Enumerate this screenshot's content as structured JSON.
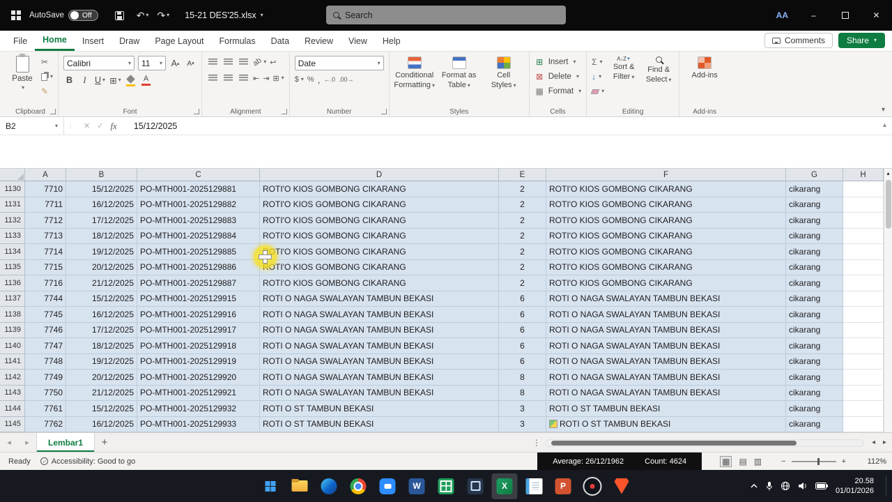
{
  "icons": {
    "caret": "▾",
    "chevron_up": "▴",
    "close": "✕",
    "minimize": "–",
    "check": "✓",
    "undo": "↶",
    "redo": "↷",
    "scissors": "✂",
    "brush": "✎",
    "sigma": "Σ",
    "down_arrow": "↓",
    "borders": "⊞",
    "merge": "⊞",
    "wrap": "↩",
    "indent_out": "⇤",
    "indent_in": "⇥",
    "orientation": "ab",
    "dollar": "$",
    "percent": "%",
    "comma": ",",
    "dec_inc": "←.0",
    "dec_dec": ".00→",
    "insert": "⊞",
    "delete": "⊠",
    "format": "▦",
    "view_normal": "▦",
    "view_layout": "▤",
    "view_break": "▥",
    "scroll_up": "▴",
    "prev": "◂",
    "next": "▸",
    "dots": "⋮",
    "plus": "+",
    "funnel": "▼",
    "grow_font": "A",
    "shrink_font": "A",
    "minus": "−",
    "plus_zoom": "+"
  },
  "titlebar": {
    "autosave_label": "AutoSave",
    "autosave_state": "Off",
    "file_name": "15-21 DES'25.xlsx",
    "search_placeholder": "Search",
    "avatar": "AA"
  },
  "ribbon": {
    "tabs": [
      {
        "label": "File"
      },
      {
        "label": "Home",
        "active": true
      },
      {
        "label": "Insert"
      },
      {
        "label": "Draw"
      },
      {
        "label": "Page Layout"
      },
      {
        "label": "Formulas"
      },
      {
        "label": "Data"
      },
      {
        "label": "Review"
      },
      {
        "label": "View"
      },
      {
        "label": "Help"
      }
    ],
    "comments_label": "Comments",
    "share_label": "Share",
    "clipboard": {
      "paste": "Paste",
      "label": "Clipboard"
    },
    "font": {
      "name": "Calibri",
      "size": "11",
      "bold": "B",
      "italic": "I",
      "underline": "U",
      "color_letter": "A",
      "label": "Font"
    },
    "alignment": {
      "label": "Alignment"
    },
    "number": {
      "format": "Date",
      "label": "Number"
    },
    "styles": {
      "cf": [
        "Conditional",
        "Formatting"
      ],
      "fat": [
        "Format as",
        "Table"
      ],
      "cs": [
        "Cell",
        "Styles"
      ],
      "label": "Styles"
    },
    "cells": {
      "insert": "Insert",
      "del": "Delete",
      "format": "Format",
      "label": "Cells"
    },
    "editing": {
      "sort": [
        "Sort &",
        "Filter"
      ],
      "find": [
        "Find &",
        "Select"
      ],
      "label": "Editing"
    },
    "addins": {
      "button": "Add-ins",
      "label": "Add-ins"
    }
  },
  "formula": {
    "name_box": "B2",
    "fx": "fx",
    "value": "15/12/2025"
  },
  "grid": {
    "columns": [
      "A",
      "B",
      "C",
      "D",
      "E",
      "F",
      "G",
      "H"
    ],
    "rows": [
      [
        1130,
        "7710",
        "15/12/2025",
        "PO-MTH001-2025129881",
        "ROTI'O KIOS GOMBONG CIKARANG",
        "2",
        "ROTI'O KIOS GOMBONG CIKARANG",
        "cikarang"
      ],
      [
        1131,
        "7711",
        "16/12/2025",
        "PO-MTH001-2025129882",
        "ROTI'O KIOS GOMBONG CIKARANG",
        "2",
        "ROTI'O KIOS GOMBONG CIKARANG",
        "cikarang"
      ],
      [
        1132,
        "7712",
        "17/12/2025",
        "PO-MTH001-2025129883",
        "ROTI'O KIOS GOMBONG CIKARANG",
        "2",
        "ROTI'O KIOS GOMBONG CIKARANG",
        "cikarang"
      ],
      [
        1133,
        "7713",
        "18/12/2025",
        "PO-MTH001-2025129884",
        "ROTI'O KIOS GOMBONG CIKARANG",
        "2",
        "ROTI'O KIOS GOMBONG CIKARANG",
        "cikarang"
      ],
      [
        1134,
        "7714",
        "19/12/2025",
        "PO-MTH001-2025129885",
        "ROTI'O KIOS GOMBONG CIKARANG",
        "2",
        "ROTI'O KIOS GOMBONG CIKARANG",
        "cikarang"
      ],
      [
        1135,
        "7715",
        "20/12/2025",
        "PO-MTH001-2025129886",
        "ROTI'O KIOS GOMBONG CIKARANG",
        "2",
        "ROTI'O KIOS GOMBONG CIKARANG",
        "cikarang"
      ],
      [
        1136,
        "7716",
        "21/12/2025",
        "PO-MTH001-2025129887",
        "ROTI'O KIOS GOMBONG CIKARANG",
        "2",
        "ROTI'O KIOS GOMBONG CIKARANG",
        "cikarang"
      ],
      [
        1137,
        "7744",
        "15/12/2025",
        "PO-MTH001-2025129915",
        "ROTI O NAGA SWALAYAN TAMBUN BEKASI",
        "6",
        "ROTI O NAGA SWALAYAN TAMBUN BEKASI",
        "cikarang"
      ],
      [
        1138,
        "7745",
        "16/12/2025",
        "PO-MTH001-2025129916",
        "ROTI O NAGA SWALAYAN TAMBUN BEKASI",
        "6",
        "ROTI O NAGA SWALAYAN TAMBUN BEKASI",
        "cikarang"
      ],
      [
        1139,
        "7746",
        "17/12/2025",
        "PO-MTH001-2025129917",
        "ROTI O NAGA SWALAYAN TAMBUN BEKASI",
        "6",
        "ROTI O NAGA SWALAYAN TAMBUN BEKASI",
        "cikarang"
      ],
      [
        1140,
        "7747",
        "18/12/2025",
        "PO-MTH001-2025129918",
        "ROTI O NAGA SWALAYAN TAMBUN BEKASI",
        "6",
        "ROTI O NAGA SWALAYAN TAMBUN BEKASI",
        "cikarang"
      ],
      [
        1141,
        "7748",
        "19/12/2025",
        "PO-MTH001-2025129919",
        "ROTI O NAGA SWALAYAN TAMBUN BEKASI",
        "6",
        "ROTI O NAGA SWALAYAN TAMBUN BEKASI",
        "cikarang"
      ],
      [
        1142,
        "7749",
        "20/12/2025",
        "PO-MTH001-2025129920",
        "ROTI O NAGA SWALAYAN TAMBUN BEKASI",
        "8",
        "ROTI O NAGA SWALAYAN TAMBUN BEKASI",
        "cikarang"
      ],
      [
        1143,
        "7750",
        "21/12/2025",
        "PO-MTH001-2025129921",
        "ROTI O NAGA SWALAYAN TAMBUN BEKASI",
        "8",
        "ROTI O NAGA SWALAYAN TAMBUN BEKASI",
        "cikarang"
      ],
      [
        1144,
        "7761",
        "15/12/2025",
        "PO-MTH001-2025129932",
        "ROTI O ST TAMBUN BEKASI",
        "3",
        "ROTI O ST TAMBUN BEKASI",
        "cikarang"
      ],
      [
        1145,
        "7762",
        "16/12/2025",
        "PO-MTH001-2025129933",
        "ROTI O ST TAMBUN BEKASI",
        "3",
        "ROTI O ST TAMBUN BEKASI",
        "cikarang"
      ]
    ]
  },
  "sheet": {
    "tab": "Lembar1"
  },
  "status": {
    "ready": "Ready",
    "accessibility": "Accessibility: Good to go",
    "average": "Average: 26/12/1962",
    "count": "Count: 4624",
    "zoom": "112%"
  },
  "taskbar": {
    "time": "20.58",
    "date": "01/01/2026",
    "icons": [
      {
        "name": "start"
      },
      {
        "name": "file-explorer"
      },
      {
        "name": "edge"
      },
      {
        "name": "chrome"
      },
      {
        "name": "zoom"
      },
      {
        "name": "word",
        "letter": "W"
      },
      {
        "name": "sheets"
      },
      {
        "name": "app"
      },
      {
        "name": "excel",
        "letter": "X",
        "active": true
      },
      {
        "name": "notepad"
      },
      {
        "name": "powerpoint",
        "letter": "P"
      },
      {
        "name": "obs"
      },
      {
        "name": "brave"
      }
    ]
  }
}
